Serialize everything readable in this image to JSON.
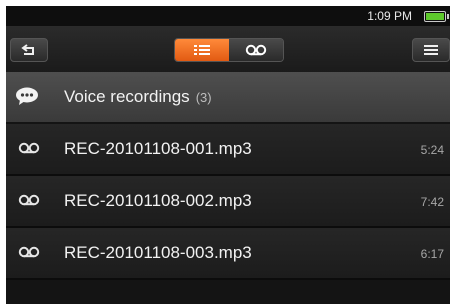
{
  "status": {
    "time": "1:09 PM"
  },
  "toolbar": {
    "back_icon": "back-arrow-icon",
    "view_list_icon": "list-view-icon",
    "view_voicemail_icon": "voice-recording-icon",
    "menu_icon": "menu-icon",
    "active_color": "#f26f22"
  },
  "header": {
    "icon": "speech-bubble-icon",
    "title": "Voice recordings",
    "count": "(3)"
  },
  "recordings": [
    {
      "name": "REC-20101108-001.mp3",
      "duration": "5:24"
    },
    {
      "name": "REC-20101108-002.mp3",
      "duration": "7:42"
    },
    {
      "name": "REC-20101108-003.mp3",
      "duration": "6:17"
    }
  ]
}
